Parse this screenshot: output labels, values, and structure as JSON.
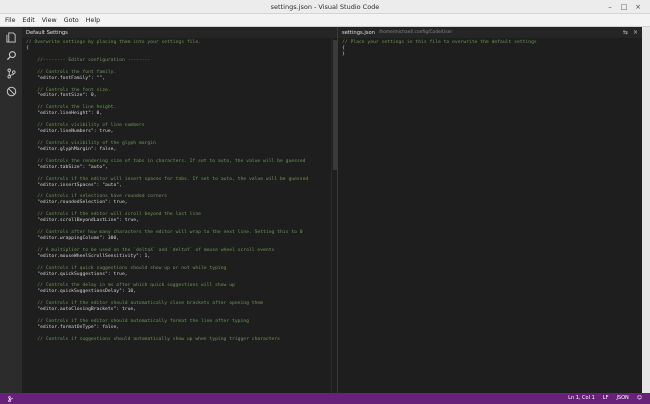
{
  "window": {
    "title": "settings.json - Visual Studio Code",
    "controls": [
      "–",
      "□",
      "×"
    ]
  },
  "menu": [
    "File",
    "Edit",
    "View",
    "Goto",
    "Help"
  ],
  "activity_icons": [
    "files-icon",
    "search-icon",
    "git-icon",
    "debug-icon"
  ],
  "left_editor": {
    "title": "Default Settings",
    "lines": [
      {
        "t": "comment",
        "v": "// Overwrite settings by placing them into your settings file."
      },
      {
        "t": "punc",
        "v": "{"
      },
      {
        "t": "blank",
        "v": ""
      },
      {
        "t": "comment",
        "v": "    //-------- Editor configuration --------"
      },
      {
        "t": "blank",
        "v": ""
      },
      {
        "t": "comment",
        "v": "    // Controls the font family."
      },
      {
        "t": "key",
        "v": "    \"editor.fontFamily\": \"\","
      },
      {
        "t": "blank",
        "v": ""
      },
      {
        "t": "comment",
        "v": "    // Controls the font size."
      },
      {
        "t": "key",
        "v": "    \"editor.fontSize\": 0,"
      },
      {
        "t": "blank",
        "v": ""
      },
      {
        "t": "comment",
        "v": "    // Controls the line height."
      },
      {
        "t": "key",
        "v": "    \"editor.lineHeight\": 0,"
      },
      {
        "t": "blank",
        "v": ""
      },
      {
        "t": "comment",
        "v": "    // Controls visibility of line numbers"
      },
      {
        "t": "key",
        "v": "    \"editor.lineNumbers\": true,"
      },
      {
        "t": "blank",
        "v": ""
      },
      {
        "t": "comment",
        "v": "    // Controls visibility of the glyph margin"
      },
      {
        "t": "key",
        "v": "    \"editor.glyphMargin\": false,"
      },
      {
        "t": "blank",
        "v": ""
      },
      {
        "t": "comment",
        "v": "    // Controls the rendering size of tabs in characters. If set to auto, the value will be guessed"
      },
      {
        "t": "key",
        "v": "    \"editor.tabSize\": \"auto\","
      },
      {
        "t": "blank",
        "v": ""
      },
      {
        "t": "comment",
        "v": "    // Controls if the editor will insert spaces for tabs. If set to auto, the value will be guessed"
      },
      {
        "t": "key",
        "v": "    \"editor.insertSpaces\": \"auto\","
      },
      {
        "t": "blank",
        "v": ""
      },
      {
        "t": "comment",
        "v": "    // Controls if selections have rounded corners"
      },
      {
        "t": "key",
        "v": "    \"editor.roundedSelection\": true,"
      },
      {
        "t": "blank",
        "v": ""
      },
      {
        "t": "comment",
        "v": "    // Controls if the editor will scroll beyond the last line"
      },
      {
        "t": "key",
        "v": "    \"editor.scrollBeyondLastLine\": true,"
      },
      {
        "t": "blank",
        "v": ""
      },
      {
        "t": "comment",
        "v": "    // Controls after how many characters the editor will wrap to the next line. Setting this to 0"
      },
      {
        "t": "key",
        "v": "    \"editor.wrappingColumn\": 300,"
      },
      {
        "t": "blank",
        "v": ""
      },
      {
        "t": "comment",
        "v": "    // A multiplier to be used on the `deltaX` and `deltaY` of mouse wheel scroll events"
      },
      {
        "t": "key",
        "v": "    \"editor.mouseWheelScrollSensitivity\": 1,"
      },
      {
        "t": "blank",
        "v": ""
      },
      {
        "t": "comment",
        "v": "    // Controls if quick suggestions should show up or not while typing"
      },
      {
        "t": "key",
        "v": "    \"editor.quickSuggestions\": true,"
      },
      {
        "t": "blank",
        "v": ""
      },
      {
        "t": "comment",
        "v": "    // Controls the delay in ms after which quick suggestions will show up"
      },
      {
        "t": "key",
        "v": "    \"editor.quickSuggestionsDelay\": 10,"
      },
      {
        "t": "blank",
        "v": ""
      },
      {
        "t": "comment",
        "v": "    // Controls if the editor should automatically close brackets after opening them"
      },
      {
        "t": "key",
        "v": "    \"editor.autoClosingBrackets\": true,"
      },
      {
        "t": "blank",
        "v": ""
      },
      {
        "t": "comment",
        "v": "    // Controls if the editor should automatically format the line after typing"
      },
      {
        "t": "key",
        "v": "    \"editor.formatOnType\": false,"
      },
      {
        "t": "blank",
        "v": ""
      },
      {
        "t": "comment",
        "v": "    // Controls if suggestions should automatically show up when typing trigger characters"
      }
    ]
  },
  "right_editor": {
    "title": "settings.json",
    "path": "/home/michael/.config/Code/User",
    "lines": [
      {
        "t": "comment",
        "v": "// Place your settings in this file to overwrite the default settings"
      },
      {
        "t": "punc",
        "v": "{"
      },
      {
        "t": "punc",
        "v": "}"
      }
    ],
    "actions": [
      "⇆",
      "×"
    ]
  },
  "status": {
    "position": "Ln 1, Col 1",
    "indent": "LF",
    "encoding": "JSON",
    "feedback": "☺"
  },
  "colors": {
    "statusbar": "#68217a",
    "editor_bg": "#1e1e1e",
    "comment": "#6a9955"
  }
}
